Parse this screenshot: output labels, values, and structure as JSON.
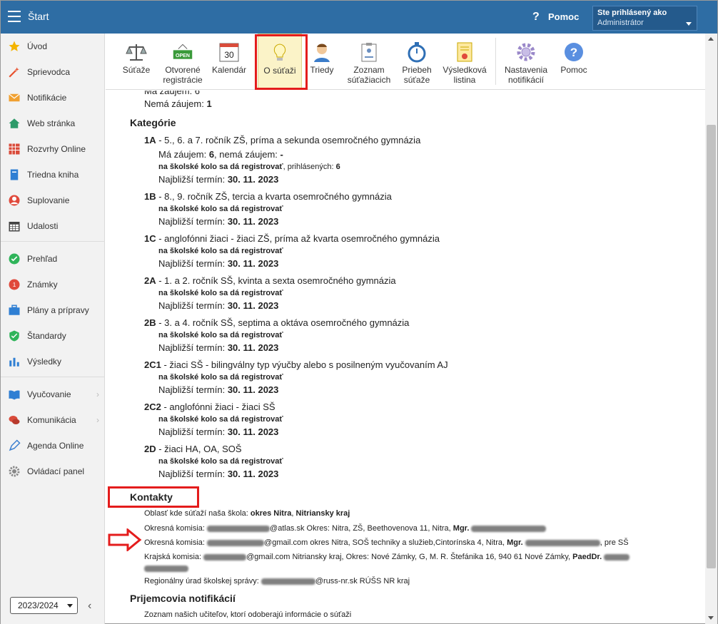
{
  "header": {
    "app_title": "Štart",
    "help_label": "Pomoc",
    "user_label": "Ste prihlásený ako",
    "user_role": "Administrátor"
  },
  "sidebar": {
    "items": [
      {
        "label": "Úvod",
        "icon": "star-icon",
        "color": "#f4b400"
      },
      {
        "label": "Sprievodca",
        "icon": "wand-icon",
        "color": "#e8502c"
      },
      {
        "label": "Notifikácie",
        "icon": "envelope-icon",
        "color": "#f0a030"
      },
      {
        "label": "Web stránka",
        "icon": "house-icon",
        "color": "#2e9b6a"
      },
      {
        "label": "Rozvrhy Online",
        "icon": "grid-icon",
        "color": "#d94b3a"
      },
      {
        "label": "Triedna kniha",
        "icon": "book-icon",
        "color": "#2f7fd3"
      },
      {
        "label": "Suplovanie",
        "icon": "person-icon",
        "color": "#e0493b"
      },
      {
        "label": "Udalosti",
        "icon": "calendar-icon",
        "color": "#444444"
      },
      {
        "label": "Prehľad",
        "icon": "check-circle-icon",
        "color": "#2fb45a"
      },
      {
        "label": "Známky",
        "icon": "grade-icon",
        "color": "#e0493b"
      },
      {
        "label": "Plány a prípravy",
        "icon": "briefcase-icon",
        "color": "#2f7fd3"
      },
      {
        "label": "Štandardy",
        "icon": "shield-check-icon",
        "color": "#2fb45a"
      },
      {
        "label": "Výsledky",
        "icon": "bar-chart-icon",
        "color": "#2f7fd3"
      },
      {
        "label": "Vyučovanie",
        "icon": "open-book-icon",
        "color": "#2f7fd3"
      },
      {
        "label": "Komunikácia",
        "icon": "chat-icon",
        "color": "#d94b3a"
      },
      {
        "label": "Agenda Online",
        "icon": "pen-icon",
        "color": "#3a7fd0"
      },
      {
        "label": "Ovládací panel",
        "icon": "gear-icon",
        "color": "#888888"
      }
    ],
    "year": "2023/2024"
  },
  "toolbar": {
    "buttons": [
      {
        "label1": "Súťaže",
        "label2": ""
      },
      {
        "label1": "Otvorené",
        "label2": "registrácie",
        "badge": "OPEN"
      },
      {
        "label1": "Kalendár",
        "label2": "",
        "badge": "30"
      },
      {
        "label1": "O súťaži",
        "label2": ""
      },
      {
        "label1": "Triedy",
        "label2": ""
      },
      {
        "label1": "Zoznam",
        "label2": "súťažiacich"
      },
      {
        "label1": "Priebeh",
        "label2": "súťaže"
      },
      {
        "label1": "Výsledková",
        "label2": "listina"
      },
      {
        "label1": "Nastavenia",
        "label2": "notifikácií"
      },
      {
        "label1": "Pomoc",
        "label2": ""
      }
    ]
  },
  "content": {
    "interest_partial": "Má záujem: 6",
    "no_interest": {
      "label": "Nemá záujem:",
      "value": "1"
    },
    "categories_title": "Kategórie",
    "categories": [
      {
        "code": "1A",
        "desc": " - 5., 6. a 7. ročník ZŠ, príma a sekunda osemročného gymnázia",
        "interest": true,
        "interest_a": "Má záujem: ",
        "interest_v1": "6",
        "interest_b": ", nemá záujem: ",
        "interest_v2": "-",
        "reg": "na školské kolo sa dá registrovať",
        "reg_extra": ", prihlásených: ",
        "reg_count": "6",
        "term_label": "Najbližší termín: ",
        "term": "30. 11. 2023"
      },
      {
        "code": "1B",
        "desc": " - 8., 9. ročník ZŠ, tercia a kvarta osemročného gymnázia",
        "reg": "na školské kolo sa dá registrovať",
        "term_label": "Najbližší termín: ",
        "term": "30. 11. 2023"
      },
      {
        "code": "1C",
        "desc": " - anglofónni žiaci - žiaci ZŠ, príma až kvarta osemročného gymnázia",
        "reg": "na školské kolo sa dá registrovať",
        "term_label": "Najbližší termín: ",
        "term": "30. 11. 2023"
      },
      {
        "code": "2A",
        "desc": " - 1. a 2. ročník SŠ, kvinta a sexta osemročného gymnázia",
        "reg": "na školské kolo sa dá registrovať",
        "term_label": "Najbližší termín: ",
        "term": "30. 11. 2023"
      },
      {
        "code": "2B",
        "desc": " - 3. a 4. ročník SŠ, septima a oktáva osemročného gymnázia",
        "reg": "na školské kolo sa dá registrovať",
        "term_label": "Najbližší termín: ",
        "term": "30. 11. 2023"
      },
      {
        "code": "2C1",
        "desc": " - žiaci SŠ - bilingválny typ výučby alebo s posilneným vyučovaním AJ",
        "reg": "na školské kolo sa dá registrovať",
        "term_label": "Najbližší termín: ",
        "term": "30. 11. 2023"
      },
      {
        "code": "2C2",
        "desc": " - anglofónni žiaci - žiaci SŠ",
        "reg": "na školské kolo sa dá registrovať",
        "term_label": "Najbližší termín: ",
        "term": "30. 11. 2023"
      },
      {
        "code": "2D",
        "desc": " - žiaci HA, OA, SOŠ",
        "reg": "na školské kolo sa dá registrovať",
        "term_label": "Najbližší termín: ",
        "term": "30. 11. 2023"
      }
    ],
    "contacts_title": "Kontakty",
    "contacts": {
      "area_label": "Oblasť kde súťaží naša škola: ",
      "area_value": "okres Nitra",
      "area_sep": ", ",
      "area_value2": "Nitriansky kraj",
      "ok1_label": "Okresná komisia: ",
      "ok1_email": "@atlas.sk",
      "ok1_rest": " Okres: Nitra, ZŠ, Beethovenova 11, Nitra, ",
      "ok1_title": "Mgr.",
      "ok2_label": "Okresná komisia: ",
      "ok2_email": "@gmail.com",
      "ok2_rest": " okres Nitra, SOŠ techniky a služieb,Cintorínska 4, Nitra, ",
      "ok2_title": "Mgr.",
      "ok2_tail": ", pre SŠ",
      "kk_label": "Krajská komisia: ",
      "kk_email": "@gmail.com",
      "kk_rest": " Nitriansky kraj, Okres: Nové Zámky, G, M. R. Štefánika 16, 940 61 Nové Zámky, ",
      "kk_title": "PaedDr.",
      "ru_label": "Regionálny úrad školskej správy: ",
      "ru_email": "@russ-nr.sk",
      "ru_rest": " RÚŠS NR kraj"
    },
    "recipients_title": "Prijemcovia notifikácií",
    "recipients_text": "Zoznam našich učiteľov, ktorí odoberajú informácie o súťaži"
  }
}
